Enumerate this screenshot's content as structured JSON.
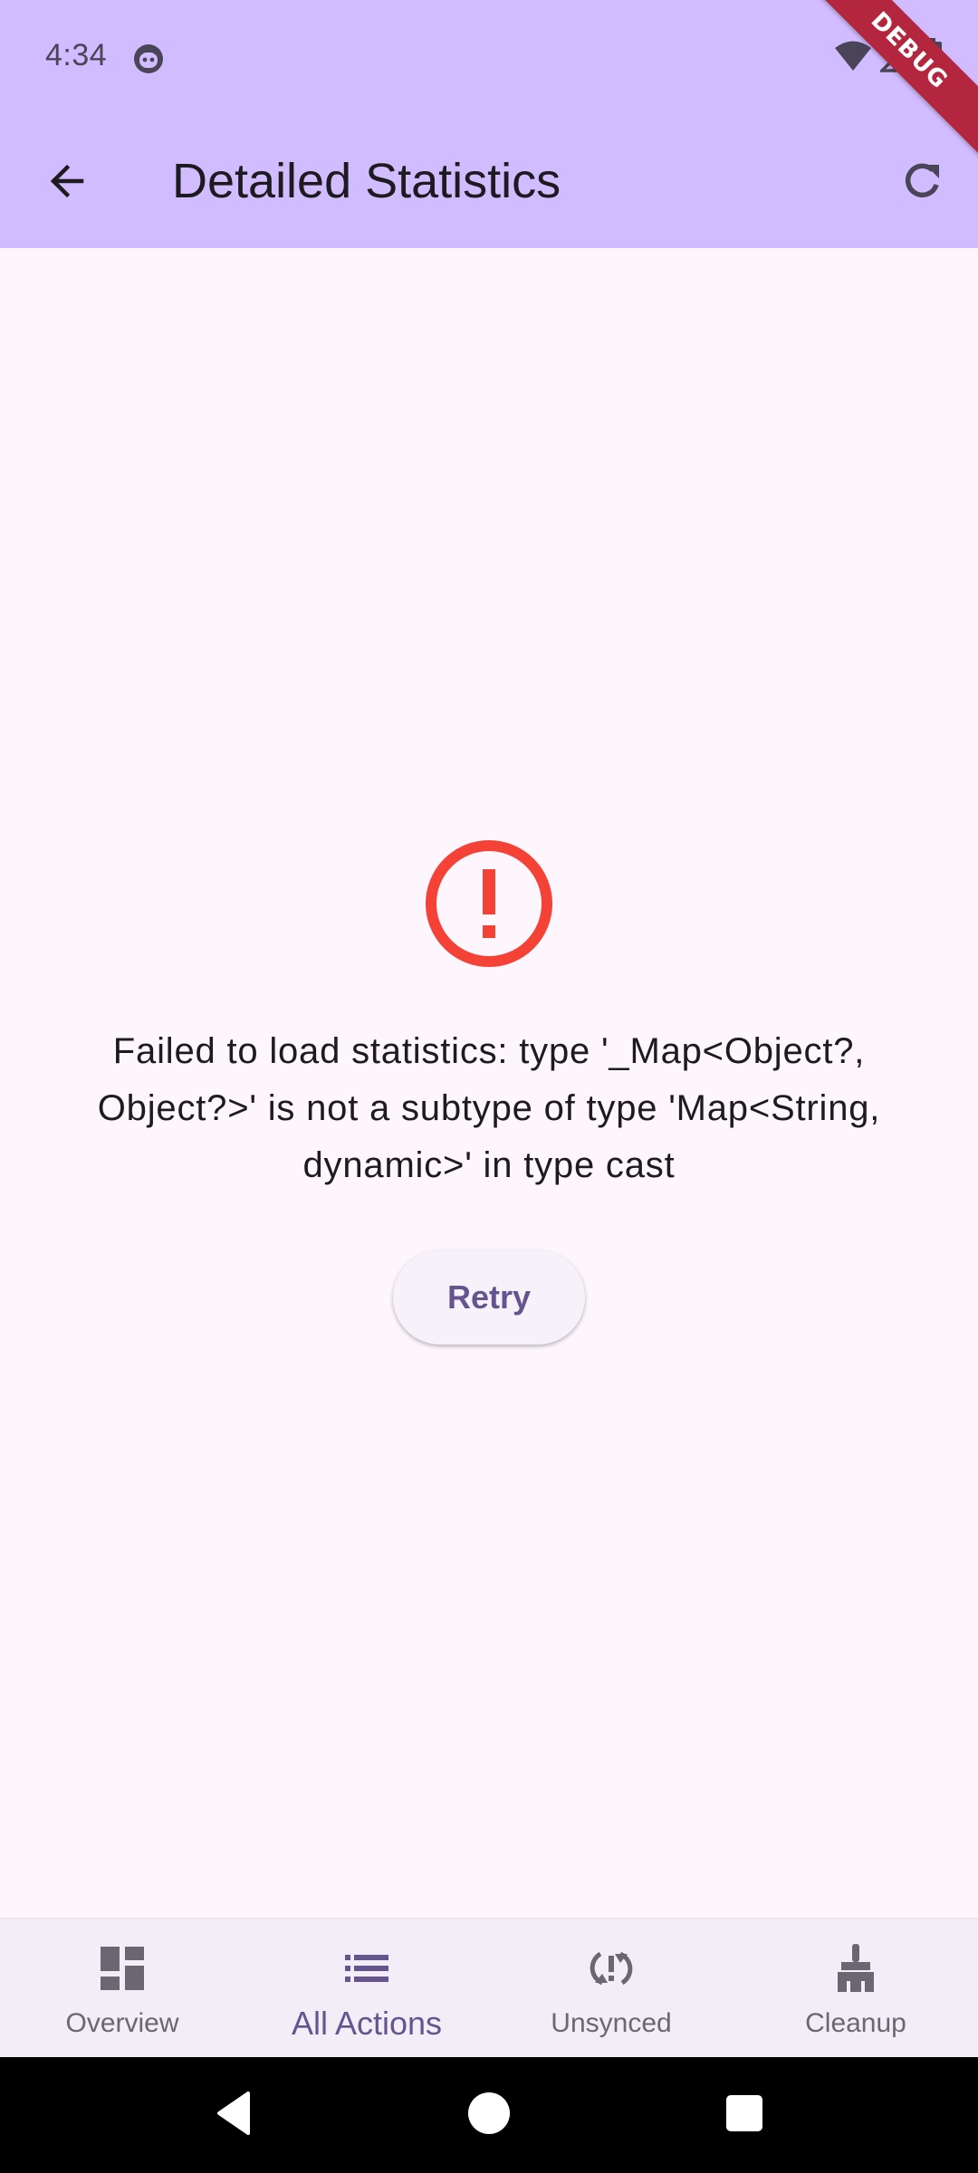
{
  "status_bar": {
    "time": "4:34",
    "icons": [
      "app-notification-icon",
      "wifi-icon",
      "signal-icon",
      "battery-icon"
    ]
  },
  "debug_banner": "DEBUG",
  "app_bar": {
    "title": "Detailed Statistics",
    "back_icon": "arrow-back-icon",
    "refresh_icon": "refresh-icon",
    "background": "#d0bcfe"
  },
  "error": {
    "icon": "error-outline-icon",
    "icon_color": "#f44336",
    "message": "Failed to load statistics: type '_Map<Object?, Object?>' is not a subtype of type 'Map<String, dynamic>' in type cast",
    "retry_label": "Retry"
  },
  "bottom_nav": {
    "items": [
      {
        "label": "Overview",
        "icon": "dashboard-icon",
        "active": false
      },
      {
        "label": "All Actions",
        "icon": "list-icon",
        "active": true
      },
      {
        "label": "Unsynced",
        "icon": "sync-problem-icon",
        "active": false
      },
      {
        "label": "Cleanup",
        "icon": "cleaning-brush-icon",
        "active": false
      }
    ],
    "active_color": "#65558f"
  },
  "system_nav": {
    "icons": [
      "back-triangle-icon",
      "home-circle-icon",
      "recents-square-icon"
    ]
  }
}
